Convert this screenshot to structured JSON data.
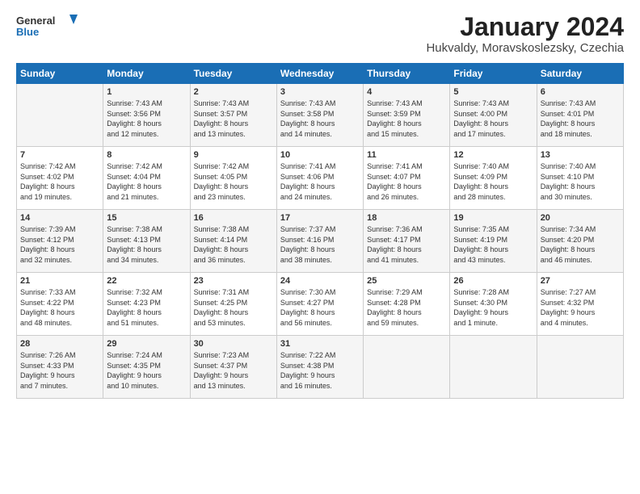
{
  "logo": {
    "general": "General",
    "blue": "Blue"
  },
  "title": "January 2024",
  "location": "Hukvaldy, Moravskoslezsky, Czechia",
  "days_header": [
    "Sunday",
    "Monday",
    "Tuesday",
    "Wednesday",
    "Thursday",
    "Friday",
    "Saturday"
  ],
  "weeks": [
    [
      {
        "day": "",
        "content": ""
      },
      {
        "day": "1",
        "content": "Sunrise: 7:43 AM\nSunset: 3:56 PM\nDaylight: 8 hours\nand 12 minutes."
      },
      {
        "day": "2",
        "content": "Sunrise: 7:43 AM\nSunset: 3:57 PM\nDaylight: 8 hours\nand 13 minutes."
      },
      {
        "day": "3",
        "content": "Sunrise: 7:43 AM\nSunset: 3:58 PM\nDaylight: 8 hours\nand 14 minutes."
      },
      {
        "day": "4",
        "content": "Sunrise: 7:43 AM\nSunset: 3:59 PM\nDaylight: 8 hours\nand 15 minutes."
      },
      {
        "day": "5",
        "content": "Sunrise: 7:43 AM\nSunset: 4:00 PM\nDaylight: 8 hours\nand 17 minutes."
      },
      {
        "day": "6",
        "content": "Sunrise: 7:43 AM\nSunset: 4:01 PM\nDaylight: 8 hours\nand 18 minutes."
      }
    ],
    [
      {
        "day": "7",
        "content": "Sunrise: 7:42 AM\nSunset: 4:02 PM\nDaylight: 8 hours\nand 19 minutes."
      },
      {
        "day": "8",
        "content": "Sunrise: 7:42 AM\nSunset: 4:04 PM\nDaylight: 8 hours\nand 21 minutes."
      },
      {
        "day": "9",
        "content": "Sunrise: 7:42 AM\nSunset: 4:05 PM\nDaylight: 8 hours\nand 23 minutes."
      },
      {
        "day": "10",
        "content": "Sunrise: 7:41 AM\nSunset: 4:06 PM\nDaylight: 8 hours\nand 24 minutes."
      },
      {
        "day": "11",
        "content": "Sunrise: 7:41 AM\nSunset: 4:07 PM\nDaylight: 8 hours\nand 26 minutes."
      },
      {
        "day": "12",
        "content": "Sunrise: 7:40 AM\nSunset: 4:09 PM\nDaylight: 8 hours\nand 28 minutes."
      },
      {
        "day": "13",
        "content": "Sunrise: 7:40 AM\nSunset: 4:10 PM\nDaylight: 8 hours\nand 30 minutes."
      }
    ],
    [
      {
        "day": "14",
        "content": "Sunrise: 7:39 AM\nSunset: 4:12 PM\nDaylight: 8 hours\nand 32 minutes."
      },
      {
        "day": "15",
        "content": "Sunrise: 7:38 AM\nSunset: 4:13 PM\nDaylight: 8 hours\nand 34 minutes."
      },
      {
        "day": "16",
        "content": "Sunrise: 7:38 AM\nSunset: 4:14 PM\nDaylight: 8 hours\nand 36 minutes."
      },
      {
        "day": "17",
        "content": "Sunrise: 7:37 AM\nSunset: 4:16 PM\nDaylight: 8 hours\nand 38 minutes."
      },
      {
        "day": "18",
        "content": "Sunrise: 7:36 AM\nSunset: 4:17 PM\nDaylight: 8 hours\nand 41 minutes."
      },
      {
        "day": "19",
        "content": "Sunrise: 7:35 AM\nSunset: 4:19 PM\nDaylight: 8 hours\nand 43 minutes."
      },
      {
        "day": "20",
        "content": "Sunrise: 7:34 AM\nSunset: 4:20 PM\nDaylight: 8 hours\nand 46 minutes."
      }
    ],
    [
      {
        "day": "21",
        "content": "Sunrise: 7:33 AM\nSunset: 4:22 PM\nDaylight: 8 hours\nand 48 minutes."
      },
      {
        "day": "22",
        "content": "Sunrise: 7:32 AM\nSunset: 4:23 PM\nDaylight: 8 hours\nand 51 minutes."
      },
      {
        "day": "23",
        "content": "Sunrise: 7:31 AM\nSunset: 4:25 PM\nDaylight: 8 hours\nand 53 minutes."
      },
      {
        "day": "24",
        "content": "Sunrise: 7:30 AM\nSunset: 4:27 PM\nDaylight: 8 hours\nand 56 minutes."
      },
      {
        "day": "25",
        "content": "Sunrise: 7:29 AM\nSunset: 4:28 PM\nDaylight: 8 hours\nand 59 minutes."
      },
      {
        "day": "26",
        "content": "Sunrise: 7:28 AM\nSunset: 4:30 PM\nDaylight: 9 hours\nand 1 minute."
      },
      {
        "day": "27",
        "content": "Sunrise: 7:27 AM\nSunset: 4:32 PM\nDaylight: 9 hours\nand 4 minutes."
      }
    ],
    [
      {
        "day": "28",
        "content": "Sunrise: 7:26 AM\nSunset: 4:33 PM\nDaylight: 9 hours\nand 7 minutes."
      },
      {
        "day": "29",
        "content": "Sunrise: 7:24 AM\nSunset: 4:35 PM\nDaylight: 9 hours\nand 10 minutes."
      },
      {
        "day": "30",
        "content": "Sunrise: 7:23 AM\nSunset: 4:37 PM\nDaylight: 9 hours\nand 13 minutes."
      },
      {
        "day": "31",
        "content": "Sunrise: 7:22 AM\nSunset: 4:38 PM\nDaylight: 9 hours\nand 16 minutes."
      },
      {
        "day": "",
        "content": ""
      },
      {
        "day": "",
        "content": ""
      },
      {
        "day": "",
        "content": ""
      }
    ]
  ]
}
